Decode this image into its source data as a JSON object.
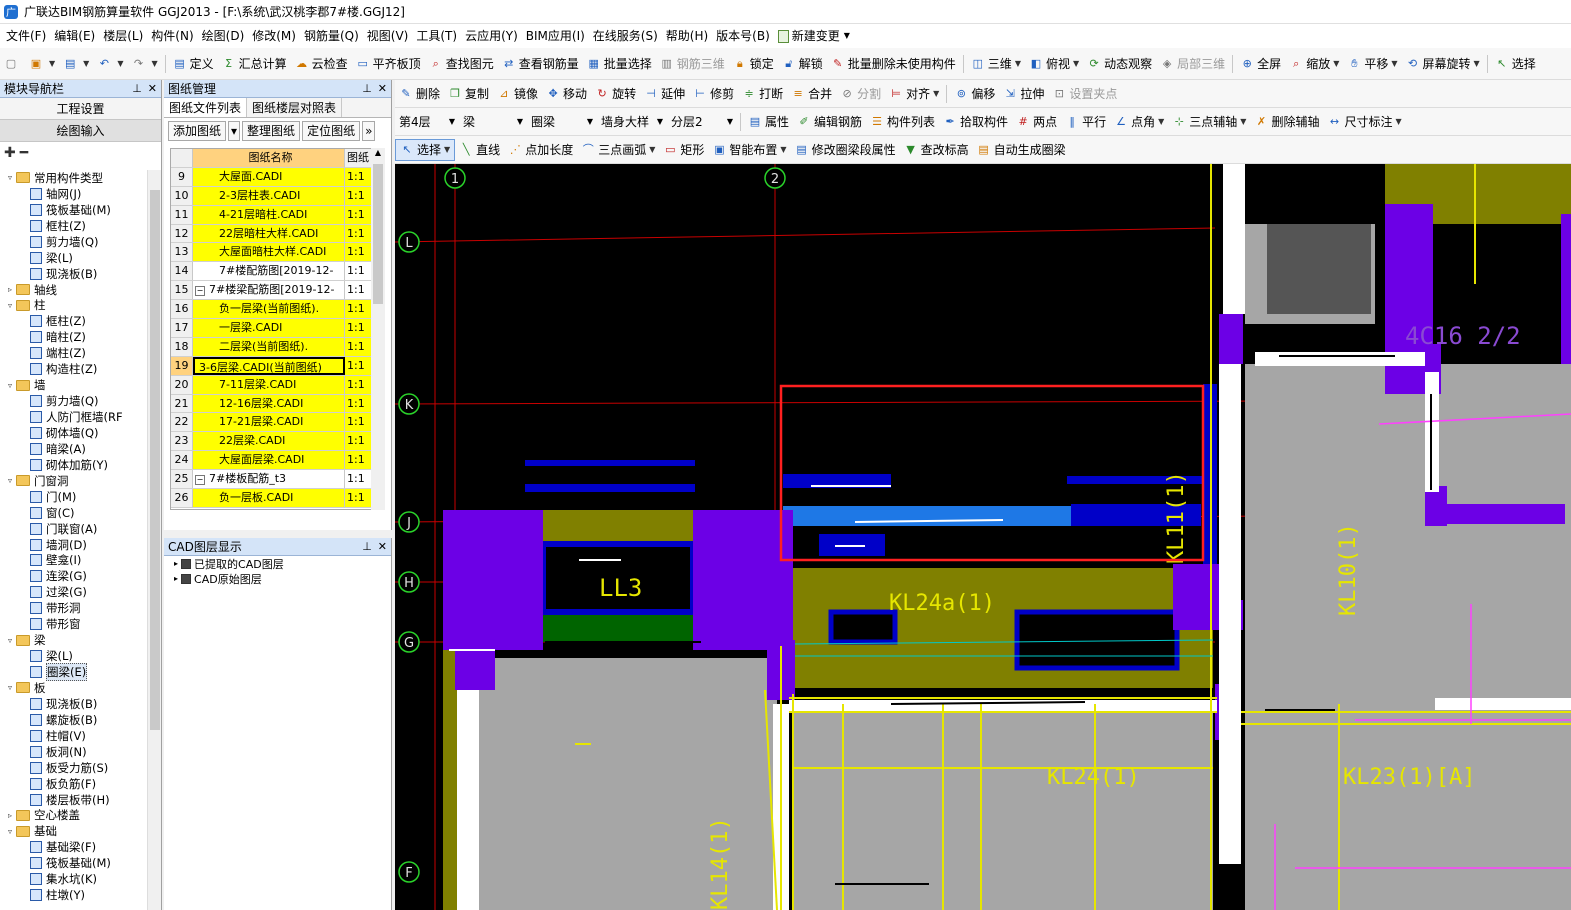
{
  "title_bar": {
    "title": "广联达BIM钢筋算量软件 GGJ2013 - [F:\\系统\\武汉桃李郡7#楼.GGJ12]"
  },
  "menu": [
    "文件(F)",
    "编辑(E)",
    "楼层(L)",
    "构件(N)",
    "绘图(D)",
    "修改(M)",
    "钢筋量(Q)",
    "视图(V)",
    "工具(T)",
    "云应用(Y)",
    "BIM应用(I)",
    "在线服务(S)",
    "帮助(H)",
    "版本号(B)"
  ],
  "menu_new_change": "新建变更",
  "toolbar1": [
    {
      "label": "定义",
      "icon": "define-icon"
    },
    {
      "label": "汇总计算",
      "icon": "sum-icon"
    },
    {
      "label": "云检查",
      "icon": "cloud-check-icon"
    },
    {
      "label": "平齐板顶",
      "icon": "align-slab-icon"
    },
    {
      "label": "查找图元",
      "icon": "find-icon"
    },
    {
      "label": "查看钢筋量",
      "icon": "rebar-view-icon"
    },
    {
      "label": "批量选择",
      "icon": "batch-select-icon"
    },
    {
      "label": "钢筋三维",
      "icon": "rebar-3d-icon",
      "disabled": true
    },
    {
      "label": "锁定",
      "icon": "lock-icon"
    },
    {
      "label": "解锁",
      "icon": "unlock-icon"
    },
    {
      "label": "批量删除未使用构件",
      "icon": "batch-delete-icon"
    },
    {
      "label": "三维",
      "icon": "3d-icon",
      "dropdown": true
    },
    {
      "label": "俯视",
      "icon": "top-view-icon",
      "dropdown": true
    },
    {
      "label": "动态观察",
      "icon": "orbit-icon"
    },
    {
      "label": "局部三维",
      "icon": "local-3d-icon",
      "disabled": true
    },
    {
      "label": "全屏",
      "icon": "fullscreen-icon"
    },
    {
      "label": "缩放",
      "icon": "zoom-icon",
      "dropdown": true
    },
    {
      "label": "平移",
      "icon": "pan-icon",
      "dropdown": true
    },
    {
      "label": "屏幕旋转",
      "icon": "rotate-screen-icon",
      "dropdown": true
    },
    {
      "label": "选择",
      "icon": "select-icon"
    }
  ],
  "toolbar2": [
    {
      "label": "删除",
      "icon": "delete-icon"
    },
    {
      "label": "复制",
      "icon": "copy-icon"
    },
    {
      "label": "镜像",
      "icon": "mirror-icon"
    },
    {
      "label": "移动",
      "icon": "move-icon"
    },
    {
      "label": "旋转",
      "icon": "rotate-icon"
    },
    {
      "label": "延伸",
      "icon": "extend-icon"
    },
    {
      "label": "修剪",
      "icon": "trim-icon"
    },
    {
      "label": "打断",
      "icon": "break-icon"
    },
    {
      "label": "合并",
      "icon": "merge-icon"
    },
    {
      "label": "分割",
      "icon": "split-icon",
      "disabled": true
    },
    {
      "label": "对齐",
      "icon": "align-icon",
      "dropdown": true
    },
    {
      "label": "偏移",
      "icon": "offset-icon"
    },
    {
      "label": "拉伸",
      "icon": "stretch-icon"
    },
    {
      "label": "设置夹点",
      "icon": "grip-icon",
      "disabled": true
    }
  ],
  "toolbar3": {
    "floor": "第4层",
    "type": "梁",
    "subtype": "圈梁",
    "component": "墙身大样",
    "layer": "分层2",
    "buttons": [
      {
        "label": "属性",
        "icon": "property-icon"
      },
      {
        "label": "编辑钢筋",
        "icon": "edit-rebar-icon"
      },
      {
        "label": "构件列表",
        "icon": "component-list-icon"
      },
      {
        "label": "拾取构件",
        "icon": "pick-icon"
      },
      {
        "label": "两点",
        "icon": "two-point-icon"
      },
      {
        "label": "平行",
        "icon": "parallel-icon"
      },
      {
        "label": "点角",
        "icon": "point-angle-icon",
        "dropdown": true
      },
      {
        "label": "三点辅轴",
        "icon": "three-point-axis-icon",
        "dropdown": true
      },
      {
        "label": "删除辅轴",
        "icon": "delete-axis-icon"
      },
      {
        "label": "尺寸标注",
        "icon": "dimension-icon",
        "dropdown": true
      }
    ]
  },
  "toolbar4": [
    {
      "label": "选择",
      "icon": "select-icon",
      "dropdown": true,
      "active": true
    },
    {
      "label": "直线",
      "icon": "line-icon"
    },
    {
      "label": "点加长度",
      "icon": "point-length-icon"
    },
    {
      "label": "三点画弧",
      "icon": "arc-icon",
      "dropdown": true
    },
    {
      "label": "矩形",
      "icon": "rect-icon"
    },
    {
      "label": "智能布置",
      "icon": "smart-layout-icon",
      "dropdown": true
    },
    {
      "label": "修改圈梁段属性",
      "icon": "modify-ring-beam-icon"
    },
    {
      "label": "查改标高",
      "icon": "elevation-icon"
    },
    {
      "label": "自动生成圈梁",
      "icon": "auto-ring-beam-icon"
    }
  ],
  "nav_panel": {
    "title": "模块导航栏",
    "project_settings": "工程设置",
    "drawing_input": "绘图输入",
    "tree": [
      {
        "level": 0,
        "label": "常用构件类型",
        "expanded": true
      },
      {
        "level": 1,
        "label": "轴网(J)"
      },
      {
        "level": 1,
        "label": "筏板基础(M)"
      },
      {
        "level": 1,
        "label": "框柱(Z)"
      },
      {
        "level": 1,
        "label": "剪力墙(Q)"
      },
      {
        "level": 1,
        "label": "梁(L)"
      },
      {
        "level": 1,
        "label": "现浇板(B)"
      },
      {
        "level": 0,
        "label": "轴线",
        "expanded": false
      },
      {
        "level": 0,
        "label": "柱",
        "expanded": true
      },
      {
        "level": 1,
        "label": "框柱(Z)"
      },
      {
        "level": 1,
        "label": "暗柱(Z)"
      },
      {
        "level": 1,
        "label": "端柱(Z)"
      },
      {
        "level": 1,
        "label": "构造柱(Z)"
      },
      {
        "level": 0,
        "label": "墙",
        "expanded": true
      },
      {
        "level": 1,
        "label": "剪力墙(Q)"
      },
      {
        "level": 1,
        "label": "人防门框墙(RF"
      },
      {
        "level": 1,
        "label": "砌体墙(Q)"
      },
      {
        "level": 1,
        "label": "暗梁(A)"
      },
      {
        "level": 1,
        "label": "砌体加筋(Y)"
      },
      {
        "level": 0,
        "label": "门窗洞",
        "expanded": true
      },
      {
        "level": 1,
        "label": "门(M)"
      },
      {
        "level": 1,
        "label": "窗(C)"
      },
      {
        "level": 1,
        "label": "门联窗(A)"
      },
      {
        "level": 1,
        "label": "墙洞(D)"
      },
      {
        "level": 1,
        "label": "壁龛(I)"
      },
      {
        "level": 1,
        "label": "连梁(G)"
      },
      {
        "level": 1,
        "label": "过梁(G)"
      },
      {
        "level": 1,
        "label": "带形洞"
      },
      {
        "level": 1,
        "label": "带形窗"
      },
      {
        "level": 0,
        "label": "梁",
        "expanded": true
      },
      {
        "level": 1,
        "label": "梁(L)"
      },
      {
        "level": 1,
        "label": "圈梁(E)",
        "selected": true
      },
      {
        "level": 0,
        "label": "板",
        "expanded": true
      },
      {
        "level": 1,
        "label": "现浇板(B)"
      },
      {
        "level": 1,
        "label": "螺旋板(B)"
      },
      {
        "level": 1,
        "label": "柱帽(V)"
      },
      {
        "level": 1,
        "label": "板洞(N)"
      },
      {
        "level": 1,
        "label": "板受力筋(S)"
      },
      {
        "level": 1,
        "label": "板负筋(F)"
      },
      {
        "level": 1,
        "label": "楼层板带(H)"
      },
      {
        "level": 0,
        "label": "空心楼盖",
        "expanded": false
      },
      {
        "level": 0,
        "label": "基础",
        "expanded": true
      },
      {
        "level": 1,
        "label": "基础梁(F)"
      },
      {
        "level": 1,
        "label": "筏板基础(M)"
      },
      {
        "level": 1,
        "label": "集水坑(K)"
      },
      {
        "level": 1,
        "label": "柱墩(Y)"
      }
    ]
  },
  "drawing_panel": {
    "title": "图纸管理",
    "tabs": [
      "图纸文件列表",
      "图纸楼层对照表"
    ],
    "buttons": [
      "添加图纸",
      "整理图纸",
      "定位图纸"
    ],
    "columns": [
      "图纸名称",
      "图纸"
    ],
    "rows": [
      {
        "num": "9",
        "name": "大屋面.CADI",
        "scale": "1:1",
        "yellow": true,
        "indent": true
      },
      {
        "num": "10",
        "name": "2-3层柱表.CADI",
        "scale": "1:1",
        "yellow": true,
        "indent": true
      },
      {
        "num": "11",
        "name": "4-21层暗柱.CADI",
        "scale": "1:1",
        "yellow": true,
        "indent": true
      },
      {
        "num": "12",
        "name": "22层暗柱大样.CADI",
        "scale": "1:1",
        "yellow": true,
        "indent": true
      },
      {
        "num": "13",
        "name": "大屋面暗柱大样.CADI",
        "scale": "1:1",
        "yellow": true,
        "indent": true
      },
      {
        "num": "14",
        "name": "7#楼配筋图[2019-12-",
        "scale": "1:1",
        "yellow": false,
        "indent": true
      },
      {
        "num": "15",
        "name": "7#楼梁配筋图[2019-12-",
        "scale": "1:1",
        "yellow": false,
        "group": true
      },
      {
        "num": "16",
        "name": "负一层梁(当前图纸).",
        "scale": "1:1",
        "yellow": true,
        "indent": true
      },
      {
        "num": "17",
        "name": "一层梁.CADI",
        "scale": "1:1",
        "yellow": true,
        "indent": true
      },
      {
        "num": "18",
        "name": "二层梁(当前图纸).",
        "scale": "1:1",
        "yellow": true,
        "indent": true
      },
      {
        "num": "19",
        "name": "3-6层梁.CADI(当前图纸)",
        "scale": "1:1",
        "yellow": true,
        "current": true
      },
      {
        "num": "20",
        "name": "7-11层梁.CADI",
        "scale": "1:1",
        "yellow": true,
        "indent": true
      },
      {
        "num": "21",
        "name": "12-16层梁.CADI",
        "scale": "1:1",
        "yellow": true,
        "indent": true
      },
      {
        "num": "22",
        "name": "17-21层梁.CADI",
        "scale": "1:1",
        "yellow": true,
        "indent": true
      },
      {
        "num": "23",
        "name": "22层梁.CADI",
        "scale": "1:1",
        "yellow": true,
        "indent": true
      },
      {
        "num": "24",
        "name": "大屋面层梁.CADI",
        "scale": "1:1",
        "yellow": true,
        "indent": true
      },
      {
        "num": "25",
        "name": "7#楼板配筋_t3",
        "scale": "1:1",
        "yellow": false,
        "group": true
      },
      {
        "num": "26",
        "name": "负一层板.CADI",
        "scale": "1:1",
        "yellow": true,
        "indent": true
      }
    ]
  },
  "layer_panel": {
    "title": "CAD图层显示",
    "rows": [
      "已提取的CAD图层",
      "CAD原始图层"
    ]
  },
  "viewport": {
    "axis_labels_top": [
      "1",
      "2"
    ],
    "axis_labels_left": [
      "L",
      "K",
      "J",
      "H",
      "G",
      "F"
    ],
    "beam_labels": [
      "LL3",
      "KL24a(1)",
      "KL11(1)",
      "KL10(1)",
      "KL24(1)",
      "KL23(1)[A]",
      "KL14(1)",
      "4C16 2/2"
    ],
    "colors": {
      "background": "#000000",
      "wall": "#6c00e6",
      "beam_olive": "#808000",
      "slab_gray": "#a0a0a0",
      "beam_blue": "#0000c8",
      "beam_lightblue": "#1e78e6",
      "grid_red": "#c80000",
      "annotation_yellow": "#e6e600",
      "highlight_red": "#ff2020",
      "green": "#008000"
    }
  }
}
